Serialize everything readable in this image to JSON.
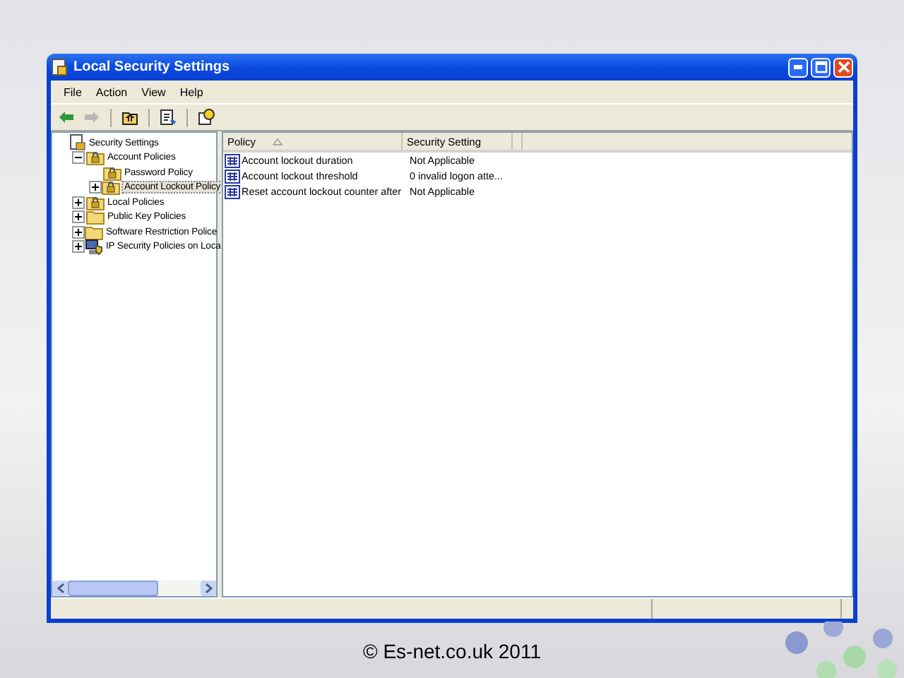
{
  "window": {
    "title": "Local Security Settings"
  },
  "menu": [
    "File",
    "Action",
    "View",
    "Help"
  ],
  "toolbar": [
    {
      "kind": "back",
      "disabled": false
    },
    {
      "kind": "forward",
      "disabled": true
    },
    {
      "kind": "up",
      "disabled": false
    },
    {
      "kind": "export",
      "disabled": false
    },
    {
      "kind": "help",
      "disabled": false
    }
  ],
  "tree": [
    {
      "label": "Security Settings",
      "kind": "security",
      "selected": false,
      "children": [
        {
          "label": "Account Policies",
          "kind": "lockfolder",
          "expanded": true,
          "selected": false,
          "children": [
            {
              "label": "Password Policy",
              "kind": "lockfolder",
              "selected": false
            },
            {
              "label": "Account Lockout Policy",
              "kind": "lockfolder",
              "expanded": false,
              "selected": true
            }
          ]
        },
        {
          "label": "Local Policies",
          "kind": "lockfolder",
          "expanded": false,
          "selected": false
        },
        {
          "label": "Public Key Policies",
          "kind": "folder",
          "expanded": false,
          "selected": false
        },
        {
          "label": "Software Restriction Police",
          "kind": "folder",
          "expanded": false,
          "selected": false
        },
        {
          "label": "IP Security Policies on Loca",
          "kind": "netsec",
          "expanded": false,
          "selected": false
        }
      ]
    }
  ],
  "table": {
    "columns": [
      {
        "label": "Policy",
        "sorted": true
      },
      {
        "label": "Security Setting",
        "sorted": false
      }
    ],
    "rows": [
      {
        "policy": "Account lockout duration",
        "setting": "Not Applicable"
      },
      {
        "policy": "Account lockout threshold",
        "setting": "0 invalid logon atte..."
      },
      {
        "policy": "Reset account lockout counter after",
        "setting": "Not Applicable"
      }
    ]
  },
  "footer": "© Es-net.co.uk 2011"
}
